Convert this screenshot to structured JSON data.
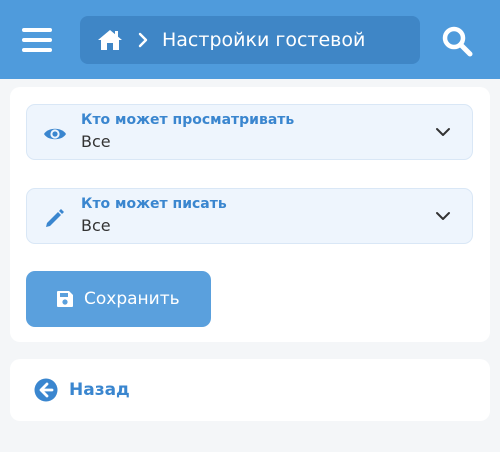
{
  "header": {
    "menu_icon": "hamburger-menu-icon",
    "home_icon": "home-icon",
    "separator_icon": "chevron-right-icon",
    "title": "Настройки гостевой",
    "search_icon": "search-icon"
  },
  "permissions": [
    {
      "icon": "eye-icon",
      "label": "Кто может просматривать",
      "value": "Все",
      "arrow_icon": "chevron-down-icon"
    },
    {
      "icon": "pencil-icon",
      "label": "Кто может писать",
      "value": "Все",
      "arrow_icon": "chevron-down-icon"
    }
  ],
  "save_button": {
    "icon": "floppy-disk-icon",
    "label": "Сохранить"
  },
  "back_link": {
    "icon": "arrow-left-circle-icon",
    "label": "Назад"
  },
  "colors": {
    "header_bg": "#4f9bdc",
    "breadcrumb_bg": "#3f86c6",
    "accent": "#3a86cf",
    "button_bg": "#5aa0dd",
    "select_bg": "#eef5fd",
    "page_bg": "#f4f6f8"
  }
}
